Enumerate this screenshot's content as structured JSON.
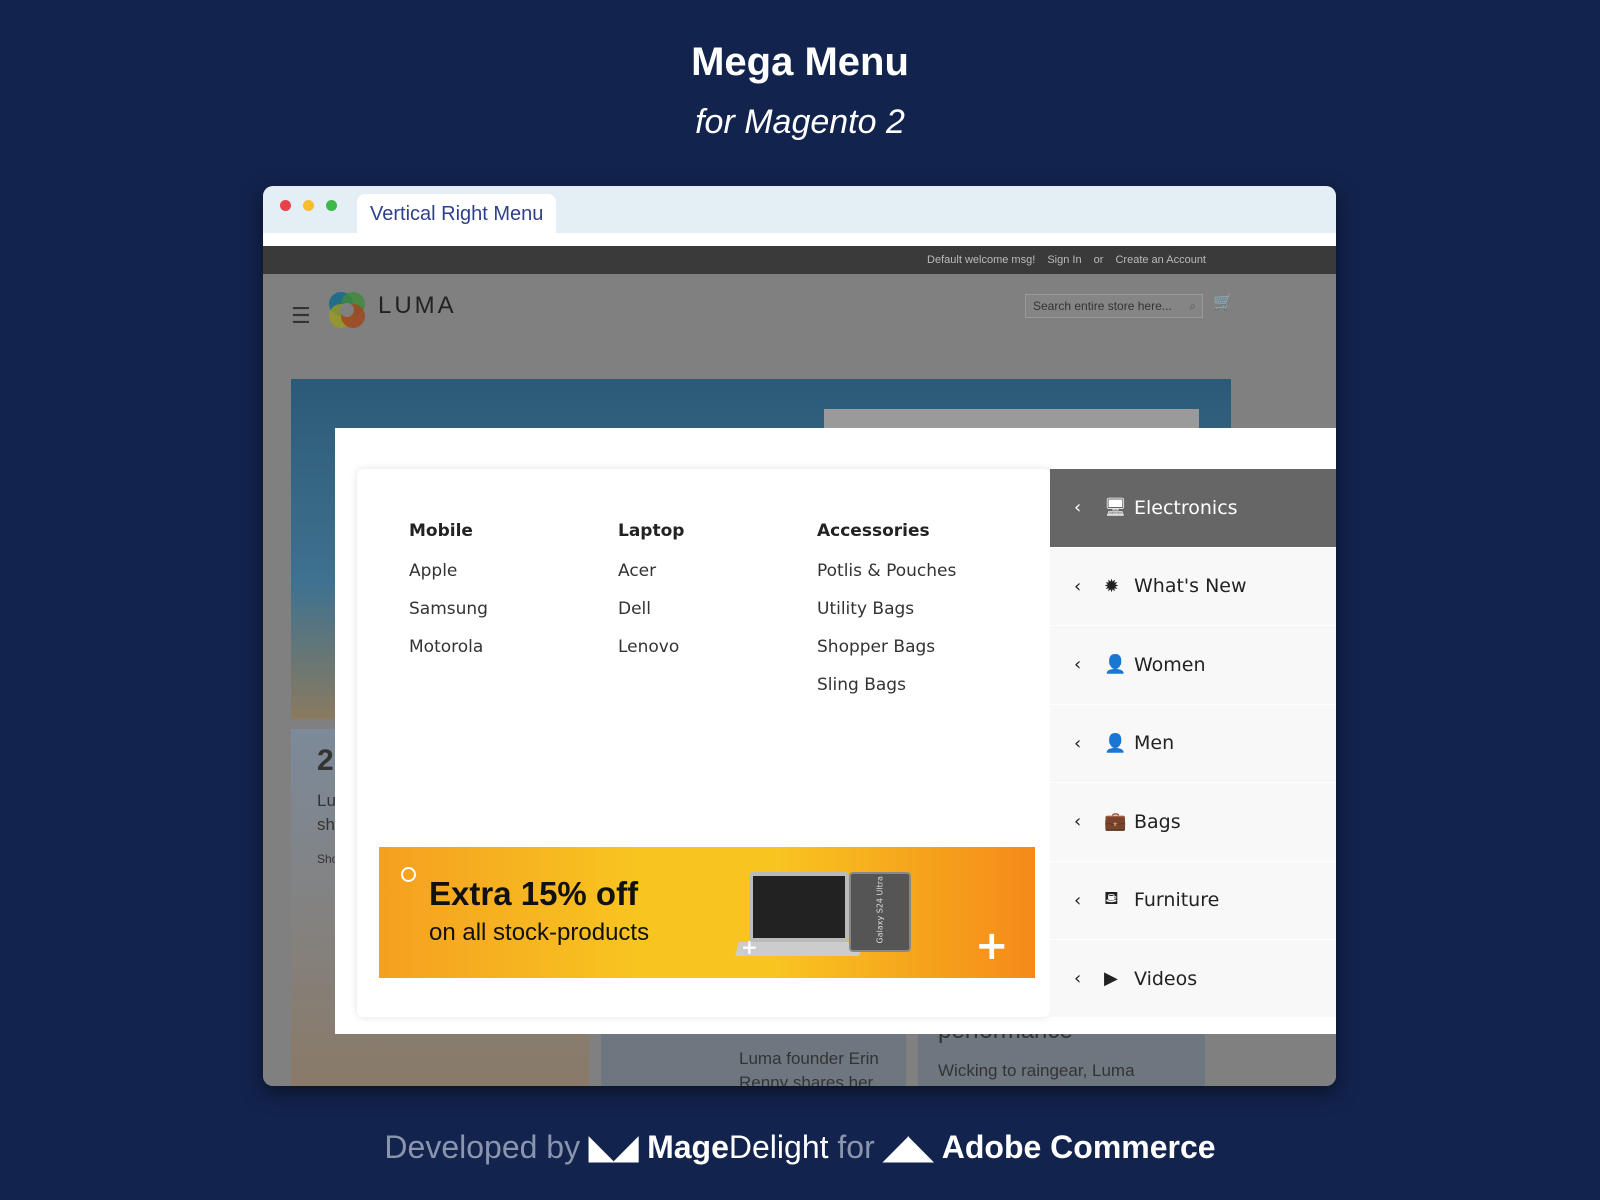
{
  "page": {
    "title": "Mega Menu",
    "subtitle": "for Magento 2"
  },
  "browser": {
    "tab_label": "Vertical Right Menu",
    "dots": [
      "#e8414d",
      "#f5be2a",
      "#3db94a"
    ]
  },
  "store": {
    "topbar": {
      "welcome": "Default welcome msg!",
      "sign_in": "Sign In",
      "or": "or",
      "create_account": "Create an Account"
    },
    "logo_text": "LUMA",
    "search_placeholder": "Search entire store here...",
    "hero_number": "2",
    "card_texts": [
      "Lu",
      "sh",
      "Sho",
      "Luma founder Erin",
      "Renny shares her",
      "performance",
      "Wicking to raingear, Luma"
    ]
  },
  "mega_menu": {
    "columns": [
      {
        "heading": "Mobile",
        "items": [
          "Apple",
          "Samsung",
          "Motorola"
        ]
      },
      {
        "heading": "Laptop",
        "items": [
          "Acer",
          "Dell",
          "Lenovo"
        ]
      },
      {
        "heading": "Accessories",
        "items": [
          "Potlis & Pouches",
          "Utility Bags",
          "Shopper Bags",
          "Sling Bags"
        ]
      }
    ],
    "banner": {
      "headline": "Extra 15% off",
      "subline": "on all stock-products",
      "phone_label": "Galaxy S24 Ultra"
    },
    "categories": [
      {
        "label": "Electronics",
        "icon": "monitor-icon",
        "active": true
      },
      {
        "label": "What's New",
        "icon": "new-badge-icon",
        "active": false
      },
      {
        "label": "Women",
        "icon": "woman-icon",
        "active": false
      },
      {
        "label": "Men",
        "icon": "man-icon",
        "active": false
      },
      {
        "label": "Bags",
        "icon": "briefcase-icon",
        "active": false
      },
      {
        "label": "Furniture",
        "icon": "armchair-icon",
        "active": false
      },
      {
        "label": "Videos",
        "icon": "play-icon",
        "active": false
      }
    ],
    "active_color": "#666666"
  },
  "footer": {
    "developed_by": "Developed by",
    "brand_bold": "Mage",
    "brand_light": "Delight",
    "for": "for",
    "platform": "Adobe Commerce"
  }
}
